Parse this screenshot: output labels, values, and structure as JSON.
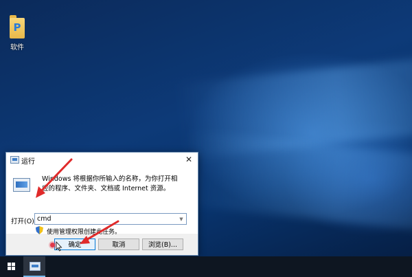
{
  "desktop": {
    "icons": [
      {
        "label": "软件"
      }
    ]
  },
  "run_dialog": {
    "title": "运行",
    "close_glyph": "✕",
    "description": "Windows 将根据你所输入的名称，为你打开相应的程序、文件夹、文档或 Internet 资源。",
    "open_label": "打开(O):",
    "open_value": "cmd",
    "admin_note": "使用管理权限创建此任务。",
    "buttons": {
      "ok": "确定",
      "cancel": "取消",
      "browse": "浏览(B)..."
    }
  },
  "taskbar": {
    "items": [
      {
        "name": "run-dialog",
        "active": true
      }
    ]
  },
  "colors": {
    "annotation_arrow": "#e02a2a",
    "accent": "#0078d7"
  }
}
